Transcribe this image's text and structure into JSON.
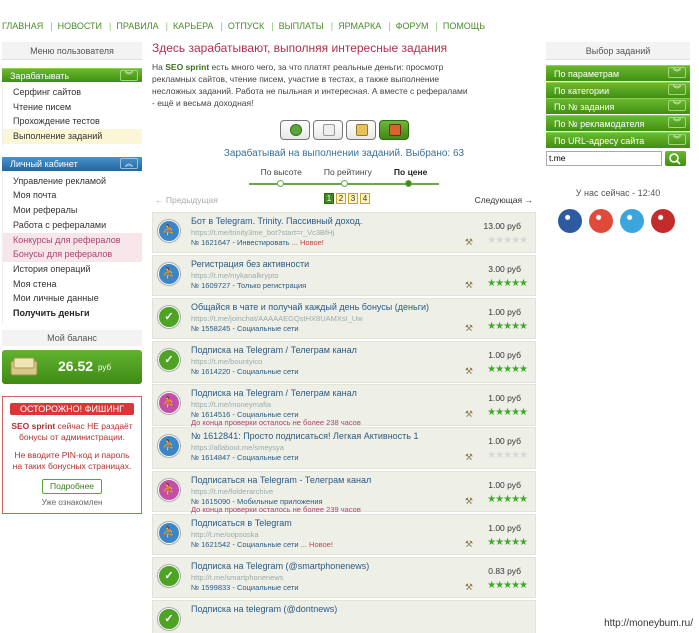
{
  "nav": [
    "ГЛАВНАЯ",
    "НОВОСТИ",
    "ПРАВИЛА",
    "КАРЬЕРА",
    "ОТПУСК",
    "ВЫПЛАТЫ",
    "ЯРМАРКА",
    "ФОРУМ",
    "ПОМОЩЬ"
  ],
  "left": {
    "user_menu_title": "Меню пользователя",
    "earn_title": "Зарабатывать",
    "earn_items": [
      "Серфинг сайтов",
      "Чтение писем",
      "Прохождение тестов",
      "Выполнение заданий"
    ],
    "cabinet_title": "Личный кабинет",
    "cabinet_items": [
      "Управление рекламой",
      "Моя почта",
      "Мои рефералы",
      "Работа с рефералами",
      "Конкурсы для рефералов",
      "Бонусы для рефералов",
      "История операций",
      "Моя стена",
      "Мои личные данные",
      "Получить деньги"
    ],
    "balance_title": "Мой баланс",
    "balance_amount": "26.52",
    "balance_currency": "руб",
    "warning_title": "ОСТОРОЖНО! ФИШИНГ",
    "warning_brand": "SEO sprint",
    "warning_text_1": " сейчас НЕ раздаёт бонусы от администрации.",
    "warning_text_2": "Не вводите PIN-код и пароль на таких бонусных страницах.",
    "warning_button": "Подробнее",
    "warning_seen": "Уже ознакомлен"
  },
  "center": {
    "title": "Здесь зарабатывают, выполняя интересные задания",
    "intro_brand": "SEO sprint",
    "intro_text": " есть много чего, за что платят реальные деньги: просмотр рекламных сайтов, чтение писем, участие в тестах, а также выполнение несложных заданий. Работа не пыльная и интересная. А вместе с рефералами - ещё и весьма доходная!",
    "intro_prefix": "На ",
    "earn_line": "Зарабатывай на выполнении заданий. Выбрано: 63",
    "sort": [
      "По высоте",
      "По рейтингу",
      "По цене"
    ],
    "prev": "← Предыдущая",
    "next": "Следующая →",
    "pages": [
      "1",
      "2",
      "3",
      "4"
    ],
    "tasks": [
      {
        "title": "Бот в Telegram. Trinity. Пассивный доход.",
        "url": "https://t.me/trinity3me_bot?start=r_Vc3BfHj",
        "meta": "№ 1621647 - Инвестировать",
        "new": " ... Новое!",
        "extra": "",
        "price": "13.00 руб",
        "icon": "blue",
        "stars": 0
      },
      {
        "title": "Регистрация без активности",
        "url": "https://t.me/mykanalkrypto",
        "meta": "№ 1609727 - Только регистрация",
        "new": "",
        "extra": "",
        "price": "3.00 руб",
        "icon": "blue",
        "stars": 5
      },
      {
        "title": "Общайся в чате и получай каждый день бонусы (деньги)",
        "url": "https://t.me/joinchat/AAAAAEGQstHX8UAMXsI_Uw",
        "meta": "№ 1558245 - Социальные сети",
        "new": "",
        "extra": "",
        "price": "1.00 руб",
        "icon": "green",
        "stars": 5
      },
      {
        "title": "Подписка на Telegram / Телеграм канал",
        "url": "https://t.me/bountyico",
        "meta": "№ 1614220 - Социальные сети",
        "new": "",
        "extra": "",
        "price": "1.00 руб",
        "icon": "green",
        "stars": 5
      },
      {
        "title": "Подписка на Telegram / Телеграм канал",
        "url": "https://t.me/moneymafia",
        "meta": "№ 1614516 - Социальные сети",
        "new": "",
        "extra": "До конца проверки осталось не более 238 часов",
        "price": "1.00 руб",
        "icon": "purple",
        "stars": 5
      },
      {
        "title": "№ 1612841: Просто подписаться! Легкая Активность 1",
        "url": "https://allabout.me/smeysya",
        "meta": "№ 1614847 - Социальные сети",
        "new": "",
        "extra": "",
        "price": "1.00 руб",
        "icon": "blue",
        "stars": 0
      },
      {
        "title": "Подписаться на Telegram - Телеграм канал",
        "url": "https://t.me/folderarchive",
        "meta": "№ 1615090 - Мобильные приложения",
        "new": "",
        "extra": "До конца проверки осталось не более 239 часов",
        "price": "1.00 руб",
        "icon": "purple",
        "stars": 5
      },
      {
        "title": "Подписаться в Telegram",
        "url": "http://t.me/oopsoska",
        "meta": "№ 1621542 - Социальные сети",
        "new": " ... Новое!",
        "extra": "",
        "price": "1.00 руб",
        "icon": "blue",
        "stars": 5
      },
      {
        "title": "Подписка на Telegram (@smartphonenews)",
        "url": "http://t.me/smartphonenews",
        "meta": "№ 1599833 - Социальные сети",
        "new": "",
        "extra": "",
        "price": "0.83 руб",
        "icon": "green",
        "stars": 5
      },
      {
        "title": "Подписка на telegram (@dontnews)",
        "url": "",
        "meta": "",
        "new": "",
        "extra": "",
        "price": "",
        "icon": "green",
        "stars": 0
      }
    ]
  },
  "right": {
    "title": "Выбор заданий",
    "filters": [
      "По параметрам",
      "По категории",
      "По № задания",
      "По № рекламодателя",
      "По URL-адресу сайта"
    ],
    "search_value": "t.me",
    "now": "У нас сейчас - 12:40",
    "social": [
      "facebook-icon",
      "google-icon",
      "twitter-icon",
      "youtube-icon"
    ]
  },
  "watermark": "http://moneybum.ru/",
  "colors": {
    "green": "#4a9a1e",
    "blue": "#2a6aa8",
    "purple": "#c040a0",
    "pink": "#b04070"
  }
}
